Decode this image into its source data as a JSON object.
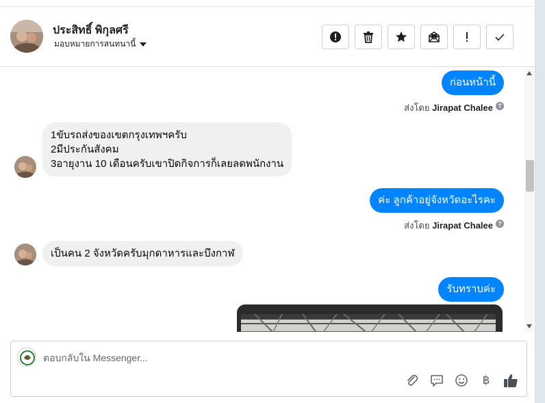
{
  "header": {
    "contact_name": "ประสิทธิ์ พิกุลศรี",
    "assign_label": "มอบหมายการสนทนานี้",
    "actions": [
      {
        "name": "alert-icon",
        "label": "alert"
      },
      {
        "name": "trash-icon",
        "label": "delete"
      },
      {
        "name": "star-icon",
        "label": "star"
      },
      {
        "name": "mail-open-icon",
        "label": "mark-unread"
      },
      {
        "name": "exclamation-icon",
        "label": "follow-up"
      },
      {
        "name": "check-icon",
        "label": "done"
      }
    ]
  },
  "messages": {
    "m1": {
      "text": "ก่อนหน้านี้",
      "sender_prefix": "ส่งโดย",
      "sender": "Jirapat Chalee"
    },
    "m2": {
      "lines": [
        "1ขับรถส่งของเขตกรุงเทพฯครับ",
        "2มีประกันสังคม",
        "3อายุงาน 10 เดือนครับเขาปิดกิจการก็เลยลดพนักงาน"
      ]
    },
    "m3": {
      "text": "ค่ะ ลูกค้าอยู่จังหวัดอะไรคะ",
      "sender_prefix": "ส่งโดย",
      "sender": "Jirapat Chalee"
    },
    "m4": {
      "text": "เป็นคน 2 จังหวัดครับมุกดาหารและบึงกาฬ"
    },
    "m5": {
      "text": "รับทราบค่ะ"
    },
    "help_glyph": "?"
  },
  "composer": {
    "placeholder": "ตอบกลับใน Messenger...",
    "tools": [
      "paperclip-icon",
      "chat-bubble-icon",
      "smile-icon",
      "baht-icon",
      "thumbs-up-icon"
    ],
    "baht_glyph": "฿"
  },
  "colors": {
    "outgoing": "#0084ff",
    "incoming": "#f0f0f0"
  }
}
